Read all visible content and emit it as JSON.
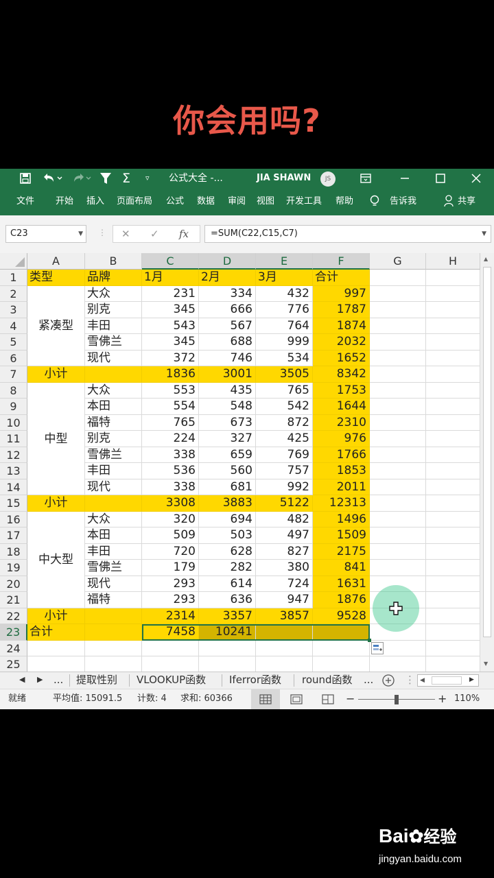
{
  "caption": "你会用吗?",
  "titlebar": {
    "document": "公式大全 -...",
    "user": "JIA SHAWN",
    "initials": "JS"
  },
  "ribbon_tabs": [
    "文件",
    "开始",
    "插入",
    "页面布局",
    "公式",
    "数据",
    "审阅",
    "视图",
    "开发工具",
    "帮助",
    "告诉我",
    "共享"
  ],
  "formula_bar": {
    "name_box": "C23",
    "fx": "fx",
    "formula": "=SUM(C22,C15,C7)"
  },
  "columns": [
    "A",
    "B",
    "C",
    "D",
    "E",
    "F",
    "G",
    "H"
  ],
  "rows": [
    "1",
    "2",
    "3",
    "4",
    "5",
    "6",
    "7",
    "8",
    "9",
    "10",
    "11",
    "12",
    "13",
    "14",
    "15",
    "16",
    "17",
    "18",
    "19",
    "20",
    "21",
    "22",
    "23",
    "24",
    "25"
  ],
  "sheet": {
    "header": [
      "类型",
      "品牌",
      "1月",
      "2月",
      "3月",
      "合计"
    ],
    "groups": [
      {
        "type": "紧凑型",
        "brands": [
          [
            "大众",
            "231",
            "334",
            "432",
            "997"
          ],
          [
            "别克",
            "345",
            "666",
            "776",
            "1787"
          ],
          [
            "丰田",
            "543",
            "567",
            "764",
            "1874"
          ],
          [
            "雪佛兰",
            "345",
            "688",
            "999",
            "2032"
          ],
          [
            "现代",
            "372",
            "746",
            "534",
            "1652"
          ]
        ],
        "subtotal": [
          "小计",
          "1836",
          "3001",
          "3505",
          "8342"
        ]
      },
      {
        "type": "中型",
        "brands": [
          [
            "大众",
            "553",
            "435",
            "765",
            "1753"
          ],
          [
            "本田",
            "554",
            "548",
            "542",
            "1644"
          ],
          [
            "福特",
            "765",
            "673",
            "872",
            "2310"
          ],
          [
            "别克",
            "224",
            "327",
            "425",
            "976"
          ],
          [
            "雪佛兰",
            "338",
            "659",
            "769",
            "1766"
          ],
          [
            "丰田",
            "536",
            "560",
            "757",
            "1853"
          ],
          [
            "现代",
            "338",
            "681",
            "992",
            "2011"
          ]
        ],
        "subtotal": [
          "小计",
          "3308",
          "3883",
          "5122",
          "12313"
        ]
      },
      {
        "type": "中大型",
        "brands": [
          [
            "大众",
            "320",
            "694",
            "482",
            "1496"
          ],
          [
            "本田",
            "509",
            "503",
            "497",
            "1509"
          ],
          [
            "丰田",
            "720",
            "628",
            "827",
            "2175"
          ],
          [
            "雪佛兰",
            "179",
            "282",
            "380",
            "841"
          ],
          [
            "现代",
            "293",
            "614",
            "724",
            "1631"
          ],
          [
            "福特",
            "293",
            "636",
            "947",
            "1876"
          ]
        ],
        "subtotal": [
          "小计",
          "2314",
          "3357",
          "3857",
          "9528"
        ]
      }
    ],
    "total": [
      "合计",
      "7458",
      "10241"
    ]
  },
  "sheet_tabs": [
    "...",
    "提取性别",
    "VLOOKUP函数",
    "Iferror函数",
    "round函数",
    "..."
  ],
  "status_bar": {
    "ready": "就绪",
    "average": "平均值: 15091.5",
    "count": "计数: 4",
    "sum": "求和: 60366",
    "zoom": "110%"
  },
  "watermark": {
    "brand": "Bai",
    "brand_cn": "经验",
    "url": "jingyan.baidu.com"
  },
  "colors": {
    "excel_green": "#217346",
    "highlight_yellow": "#ffd800",
    "caption_red": "#e8584a"
  }
}
